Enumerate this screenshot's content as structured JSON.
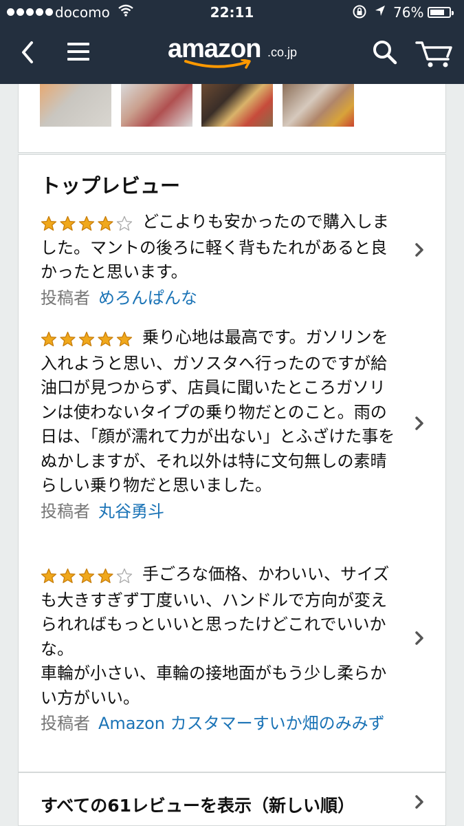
{
  "status_bar": {
    "carrier": "docomo",
    "time": "22:11",
    "battery_percent_label": "76%",
    "battery_level": 0.76
  },
  "header": {
    "logo_word": "amazon",
    "logo_tld": ".co.jp",
    "icons": [
      "back-chevron-icon",
      "hamburger-menu-icon",
      "search-icon",
      "cart-icon"
    ],
    "background_color": "#232f3e",
    "accent_color": "#ff9900"
  },
  "top_reviews": {
    "title": "トップレビュー",
    "author_prefix": "投稿者",
    "reviews": [
      {
        "rating": 4,
        "text": "どこよりも安かったので購入しました。マントの後ろに軽く背もたれがあると良かったと思います。",
        "author": "めろんぱんな"
      },
      {
        "rating": 5,
        "text": "乗り心地は最高です。ガソリンを入れようと思い、ガソスタへ行ったのですが給油口が見つからず、店員に聞いたところガソリンは使わないタイプの乗り物だとのこと。雨の日は、「顔が濡れて力が出ない」とふざけた事をぬかしますが、それ以外は特に文句無しの素晴らしい乗り物だと思いました。",
        "author": "丸谷勇斗"
      },
      {
        "rating": 4,
        "text": "手ごろな価格、かわいい、サイズも大きすぎず丁度いい、ハンドルで方向が変えられればもっといいと思ったけどこれでいいかな。",
        "text_line2": "車輪が小さい、車輪の接地面がもう少し柔らかい方がいい。",
        "author": "Amazon カスタマーすいか畑のみみず"
      }
    ],
    "star_color": "#f0a81c",
    "link_color": "#1a73b6"
  },
  "all_reviews_link": "すべての61レビューを表示（新しい順）"
}
